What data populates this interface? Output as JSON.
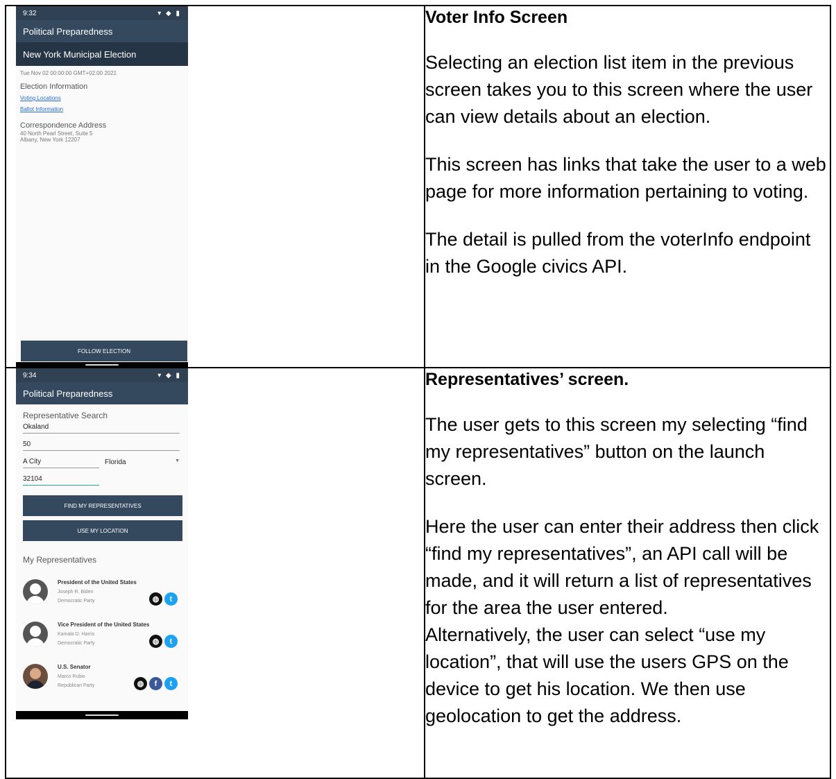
{
  "row1": {
    "screen": {
      "status_time": "9:32",
      "app_title": "Political Preparedness",
      "election_name": "New York Municipal Election",
      "election_date": "Tue Nov 02 00:00:00 GMT+02:00 2021",
      "election_info_title": "Election Information",
      "voting_locations_link": "Voting Locations",
      "ballot_info_link": "Ballot Information",
      "correspondence_title": "Correspondence Address",
      "address_line1": "40 North Pearl Street, Suite 5",
      "address_line2": "Albany, New York 12207",
      "follow_button": "FOLLOW ELECTION"
    },
    "heading": "Voter Info Screen",
    "paragraphs": [
      "Selecting an election list item in the previous screen takes you to this screen where the user can view details about an election.",
      "This screen has links that take the user to a web page for more information pertaining to voting.",
      "The detail is pulled from the voterInfo endpoint in the Google civics API."
    ]
  },
  "row2": {
    "screen": {
      "status_time": "9:34",
      "app_title": "Political Preparedness",
      "search_title": "Representative Search",
      "address_line1_value": "Okaland",
      "address_line2_value": "50",
      "city_value": "A City",
      "state_value": "Florida",
      "zip_value": "32104",
      "find_button": "FIND MY REPRESENTATIVES",
      "location_button": "USE MY LOCATION",
      "list_title": "My Representatives",
      "representatives": [
        {
          "office": "President of the United States",
          "name": "Joseph R. Biden",
          "party": "Democratic Party",
          "icons": [
            "globe-icon",
            "twitter-icon"
          ]
        },
        {
          "office": "Vice President of the United States",
          "name": "Kamala D. Harris",
          "party": "Democratic Party",
          "icons": [
            "globe-icon",
            "twitter-icon"
          ]
        },
        {
          "office": "U.S. Senator",
          "name": "Marco Rubio",
          "party": "Republican Party",
          "icons": [
            "globe-icon",
            "facebook-icon",
            "twitter-icon"
          ]
        }
      ]
    },
    "heading": "Representatives’ screen.",
    "paragraphs": [
      "The user gets to this screen my selecting “find my representatives” button on the launch screen.",
      "Here the user can enter their address then click “find my representatives”, an API call will be made, and it will return a list of representatives for the area the user entered.",
      "Alternatively, the user can select “use my location”, that will use the users GPS on the device to get his location. We then use geolocation to get the address."
    ]
  }
}
